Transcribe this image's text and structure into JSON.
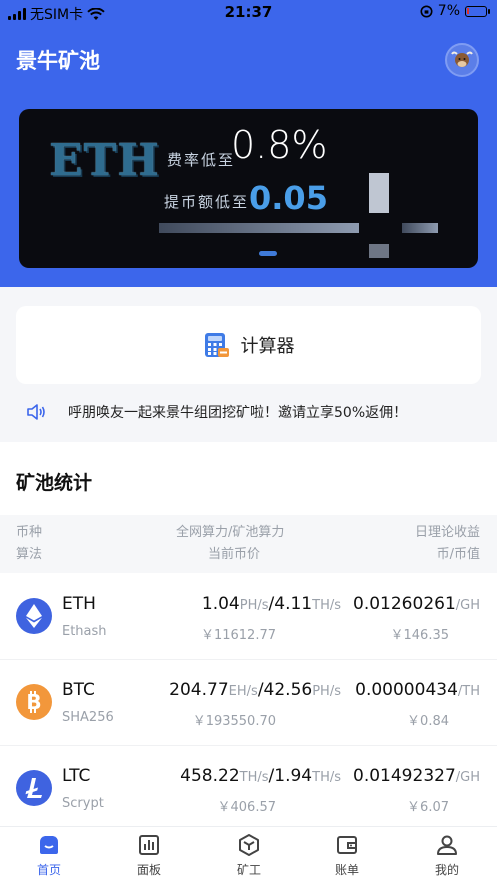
{
  "status_bar": {
    "carrier": "无SIM卡",
    "time": "21:37",
    "battery": "7%",
    "battery_level": 0.07
  },
  "header": {
    "title": "景牛矿池"
  },
  "banner": {
    "coin": "ETH",
    "fee_label": "费率低至",
    "fee_value": "0.8%",
    "min_label": "提币额低至",
    "min_value": "0.05"
  },
  "calculator": {
    "label": "计算器"
  },
  "notice": {
    "text": "呼朋唤友一起来景牛组团挖矿啦！邀请立享50%返佣！"
  },
  "stats": {
    "title": "矿池统计",
    "headers": {
      "coin": "币种",
      "algo": "算法",
      "hashrate": "全网算力/矿池算力",
      "price": "当前币价",
      "income": "日理论收益",
      "income_unit": "币/币值"
    },
    "rows": [
      {
        "coin": "ETH",
        "algo": "Ethash",
        "net_hash": "1.04",
        "net_unit": "PH/s",
        "pool_hash": "4.11",
        "pool_unit": "TH/s",
        "price": "￥11612.77",
        "income": "0.01260261",
        "income_unit": "/GH",
        "income_cny": "￥146.35",
        "color": "#3f63e0"
      },
      {
        "coin": "BTC",
        "algo": "SHA256",
        "net_hash": "204.77",
        "net_unit": "EH/s",
        "pool_hash": "42.56",
        "pool_unit": "PH/s",
        "price": "￥193550.70",
        "income": "0.00000434",
        "income_unit": "/TH",
        "income_cny": "￥0.84",
        "color": "#f2973b"
      },
      {
        "coin": "LTC",
        "algo": "Scrypt",
        "net_hash": "458.22",
        "net_unit": "TH/s",
        "pool_hash": "1.94",
        "pool_unit": "TH/s",
        "price": "￥406.57",
        "income": "0.01492327",
        "income_unit": "/GH",
        "income_cny": "￥6.07",
        "color": "#3f63e0"
      }
    ]
  },
  "tabbar": {
    "tabs": [
      {
        "label": "首页",
        "icon": "home-icon",
        "active": true
      },
      {
        "label": "面板",
        "icon": "chart-icon",
        "active": false
      },
      {
        "label": "矿工",
        "icon": "cube-icon",
        "active": false
      },
      {
        "label": "账单",
        "icon": "wallet-icon",
        "active": false
      },
      {
        "label": "我的",
        "icon": "user-icon",
        "active": false
      }
    ]
  },
  "colors": {
    "brand_blue": "#3c66eb",
    "banner_bg": "#0a0b10"
  }
}
